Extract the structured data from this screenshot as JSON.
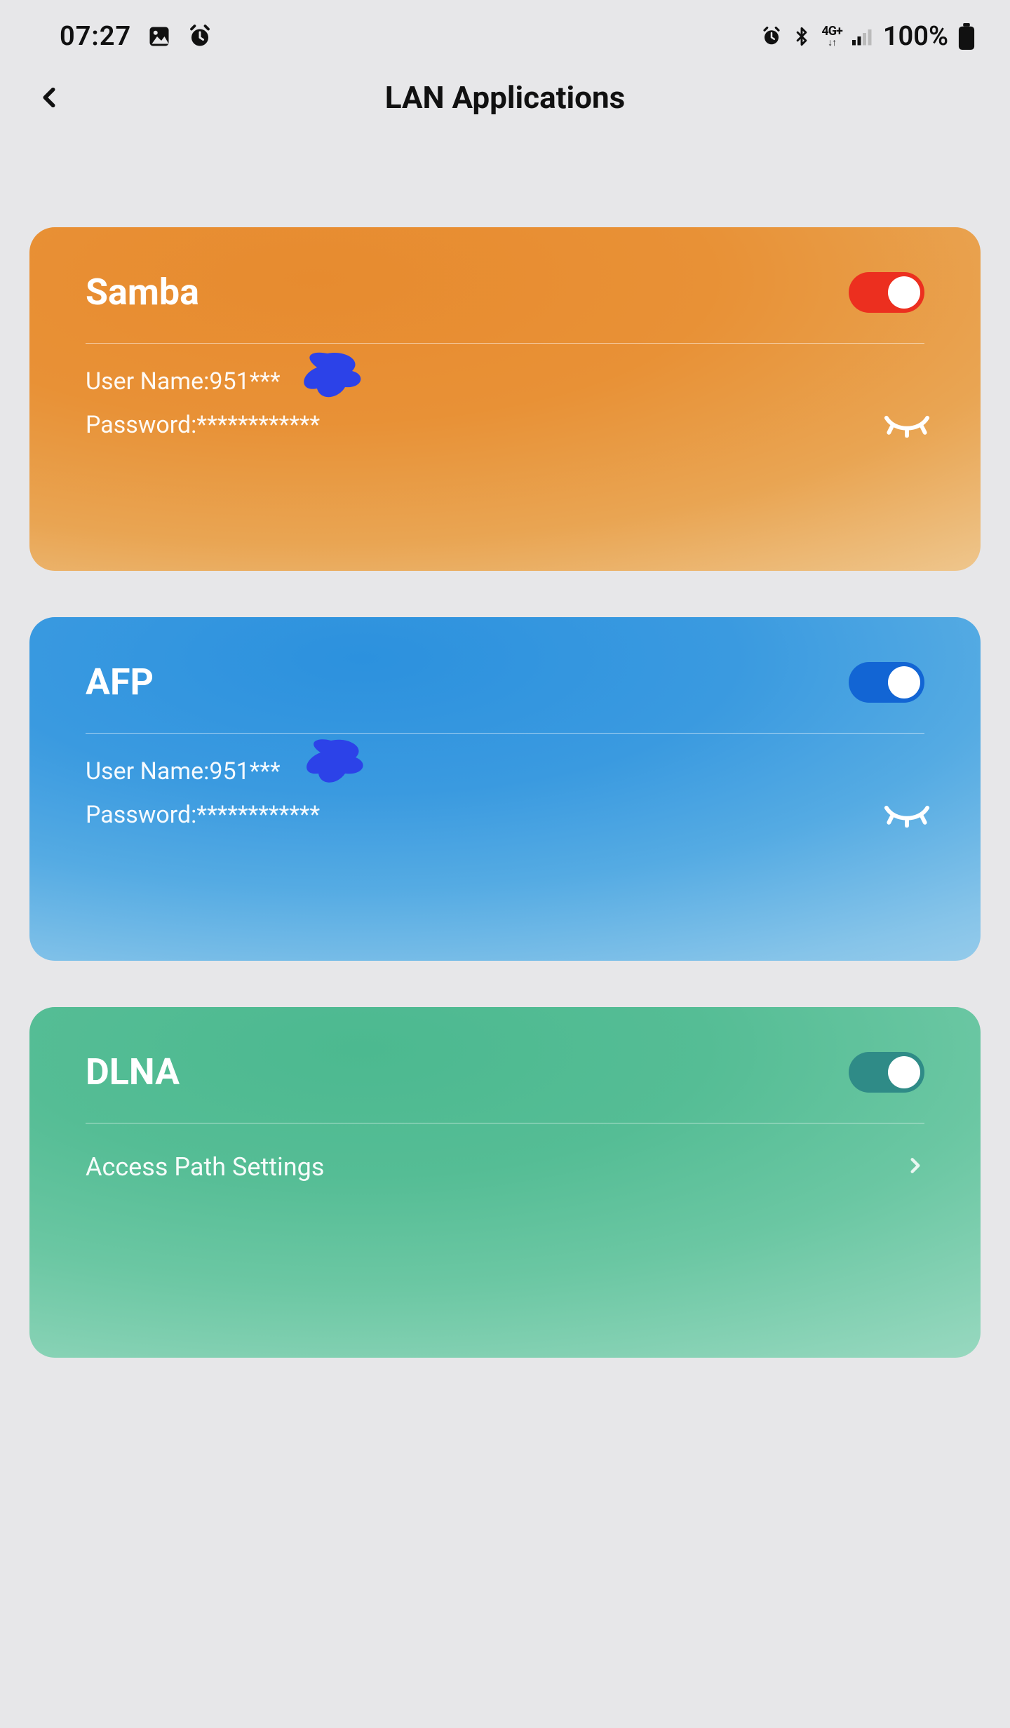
{
  "status": {
    "time": "07:27",
    "battery": "100%"
  },
  "header": {
    "title": "LAN Applications"
  },
  "cards": {
    "samba": {
      "title": "Samba",
      "username_label": "User Name:",
      "username_value": "951***",
      "password_label": "Password:",
      "password_value": "************",
      "toggle_on": true
    },
    "afp": {
      "title": "AFP",
      "username_label": "User Name:",
      "username_value": "951***",
      "password_label": "Password:",
      "password_value": "************",
      "toggle_on": true
    },
    "dlna": {
      "title": "DLNA",
      "path_label": "Access Path Settings",
      "toggle_on": true
    }
  }
}
